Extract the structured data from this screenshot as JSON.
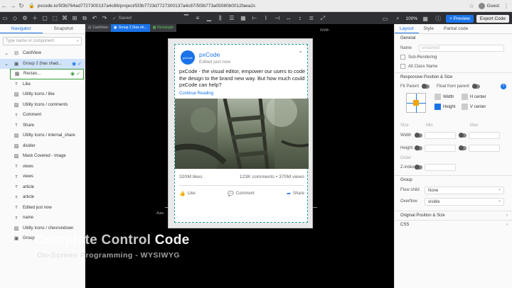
{
  "browser": {
    "url": "pxcode.io/5f3b764ad7727300137a4c86/project/5f3b7723d7727300137a4c87/5f3b773a05080b0012faea2c",
    "user": "Guest"
  },
  "toolbar": {
    "saved_label": "Saved",
    "zoom": "100%",
    "preview_label": "Preview",
    "export_label": "Export Code"
  },
  "navigator": {
    "tabs": [
      "Navigator",
      "Snapshot"
    ],
    "search_placeholder": "Type name or component",
    "items": [
      {
        "label": "CardView",
        "icon": "layers-icon"
      },
      {
        "label": "Group 2 (has shad...",
        "icon": "folder-icon"
      },
      {
        "label": "Rectan...",
        "icon": "grid-icon"
      },
      {
        "label": "Like",
        "icon": "text-icon"
      },
      {
        "label": "Utility Icons / like",
        "icon": "image-icon"
      },
      {
        "label": "Utility Icons / comments",
        "icon": "image-icon"
      },
      {
        "label": "Comment",
        "icon": "text-icon"
      },
      {
        "label": "Share",
        "icon": "text-icon"
      },
      {
        "label": "Utility Icons / internal_share",
        "icon": "image-icon"
      },
      {
        "label": "divider",
        "icon": "image-icon"
      },
      {
        "label": "Mask Covered - Image",
        "icon": "image-icon"
      },
      {
        "label": "views",
        "icon": "text-icon"
      },
      {
        "label": "views",
        "icon": "text-icon"
      },
      {
        "label": "article",
        "icon": "text-icon"
      },
      {
        "label": "article",
        "icon": "text-icon"
      },
      {
        "label": "Edited just now",
        "icon": "text-icon"
      },
      {
        "label": "name",
        "icon": "text-icon"
      },
      {
        "label": "Utility Icons / chevrondown",
        "icon": "image-icon"
      },
      {
        "label": "Group",
        "icon": "folder-icon"
      }
    ]
  },
  "canvas": {
    "breadcrumbs": [
      "CardView",
      "Group 2 (has sh...",
      "Rectangle"
    ],
    "width_label": "Width",
    "auto_label": "Auto"
  },
  "card": {
    "logo_text": "pxCode",
    "name": "pxCode",
    "subtitle": "Edited just now",
    "text": "pxCode - the visual editor, empower our users to code the design to the brand new way. But how much could pxCode can help?",
    "link": "Continue Reading",
    "likes": "320M likes",
    "comments_views": "123K comments • 370M views",
    "actions": [
      "Like",
      "Comment",
      "Share"
    ]
  },
  "inspector": {
    "tabs": [
      "Layout",
      "Style",
      "Partial code"
    ],
    "general_title": "General",
    "name_label": "Name",
    "name_placeholder": "unnamed",
    "sub_rendering": "Sub-Rendering",
    "alt_class": "Alt Class Name",
    "responsive_title": "Responsive Position & Size",
    "fit_parent": "Fit Parent",
    "float_parent": "Float from parent",
    "width_label": "Width",
    "height_label": "Height",
    "h_center": "H center",
    "v_center": "V center",
    "size_label": "Size",
    "min_label": "Min",
    "max_label": "Max",
    "order_label": "Order",
    "zindex_label": "Z-index",
    "group_title": "Group",
    "flow_child": "Flow child",
    "flow_value": "None",
    "overflow_label": "Overflow",
    "overflow_value": "visible",
    "original_title": "Original Position & Size",
    "css_title": "CSS"
  },
  "caption": {
    "line1_a": "Complete Control ",
    "line1_b": "Code",
    "line2": "On-Screen Programming - WYSIWYG"
  },
  "colors": {
    "accent": "#1a73e8",
    "toolbar": "#2d2f33",
    "selection_green": "#3a9a3a"
  }
}
